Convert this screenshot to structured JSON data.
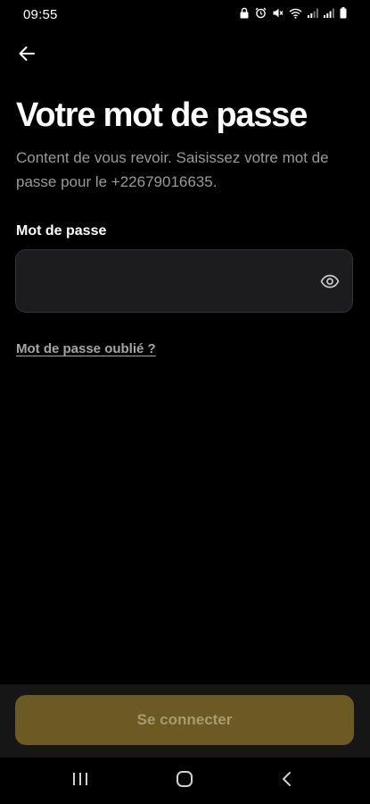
{
  "status_bar": {
    "time": "09:55",
    "icons": [
      "lock-icon",
      "alarm-icon",
      "mute-icon",
      "wifi-icon",
      "signal-icon",
      "signal-icon",
      "battery-icon"
    ]
  },
  "header": {
    "back_icon": "arrow-left-icon"
  },
  "main": {
    "title": "Votre mot de passe",
    "subtitle": "Content de vous revoir. Saisissez votre mot de passe pour le +22679016635.",
    "password_field": {
      "label": "Mot de passe",
      "value": "",
      "toggle_icon": "eye-icon"
    },
    "forgot_password_link": "Mot de passe oublié ?"
  },
  "footer": {
    "connect_button_label": "Se connecter",
    "connect_button_color": "#6b5a23"
  },
  "nav_bar": {
    "icons": [
      "recent-apps-icon",
      "home-icon",
      "back-icon"
    ]
  },
  "colors": {
    "background": "#000000",
    "field_background": "#1c1c1e",
    "subtitle_text": "#9a9a9a",
    "accent": "#6b5a23"
  }
}
